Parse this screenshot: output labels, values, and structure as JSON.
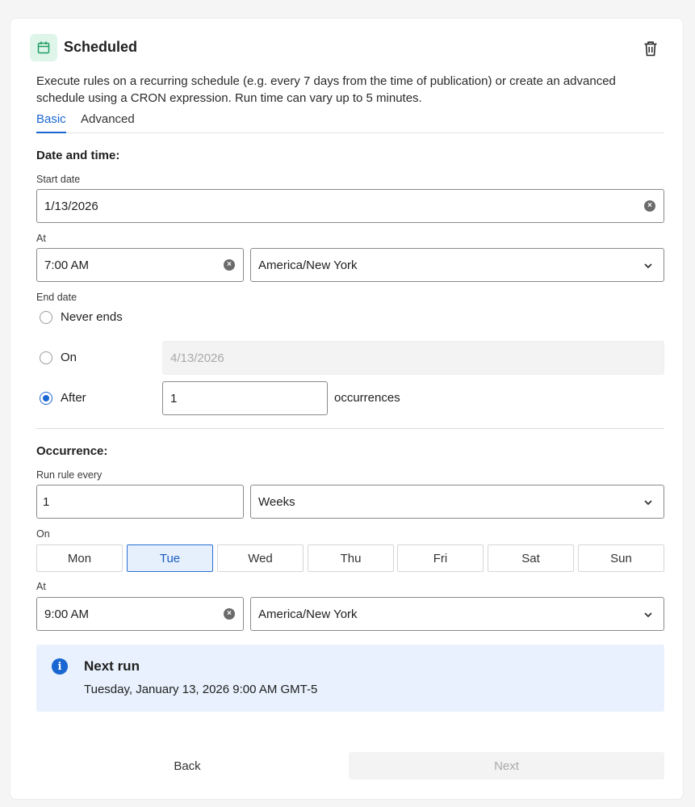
{
  "panel": {
    "title": "Scheduled",
    "description": "Execute rules on a recurring schedule (e.g. every 7 days from the time of publication) or create an advanced schedule using a CRON expression. Run time can vary up to 5 minutes."
  },
  "tabs": [
    {
      "label": "Basic",
      "active": true
    },
    {
      "label": "Advanced",
      "active": false
    }
  ],
  "date_time": {
    "section_title": "Date and time:",
    "start_date_label": "Start date",
    "start_date_value": "1/13/2026",
    "at_label": "At",
    "at_time_value": "7:00 AM",
    "at_timezone": "America/New York",
    "end_date_label": "End date",
    "end_options": [
      {
        "label": "Never ends",
        "checked": false
      },
      {
        "label": "On",
        "checked": false
      },
      {
        "label": "After",
        "checked": true
      }
    ],
    "on_date_value": "4/13/2026",
    "after_count_value": "1",
    "after_suffix": "occurrences"
  },
  "occurrence": {
    "section_title": "Occurrence:",
    "run_every_label": "Run rule every",
    "run_every_value": "1",
    "unit_value": "Weeks",
    "on_label": "On",
    "days": [
      {
        "label": "Mon",
        "selected": false
      },
      {
        "label": "Tue",
        "selected": true
      },
      {
        "label": "Wed",
        "selected": false
      },
      {
        "label": "Thu",
        "selected": false
      },
      {
        "label": "Fri",
        "selected": false
      },
      {
        "label": "Sat",
        "selected": false
      },
      {
        "label": "Sun",
        "selected": false
      }
    ],
    "at_label": "At",
    "at_time_value": "9:00 AM",
    "at_timezone": "America/New York"
  },
  "next_run": {
    "title": "Next run",
    "value": "Tuesday, January 13, 2026 9:00 AM GMT-5"
  },
  "footer": {
    "back_label": "Back",
    "next_label": "Next"
  },
  "colors": {
    "accent": "#1a66d2",
    "header_icon_bg": "#dff5ea",
    "header_icon_fg": "#1f9d63",
    "info_bg": "#e8f1fd"
  },
  "icons": {
    "header": "calendar-icon",
    "delete": "trash-icon",
    "clear": "clear-icon",
    "dropdown": "chevron-down-icon",
    "info": "info-icon"
  }
}
